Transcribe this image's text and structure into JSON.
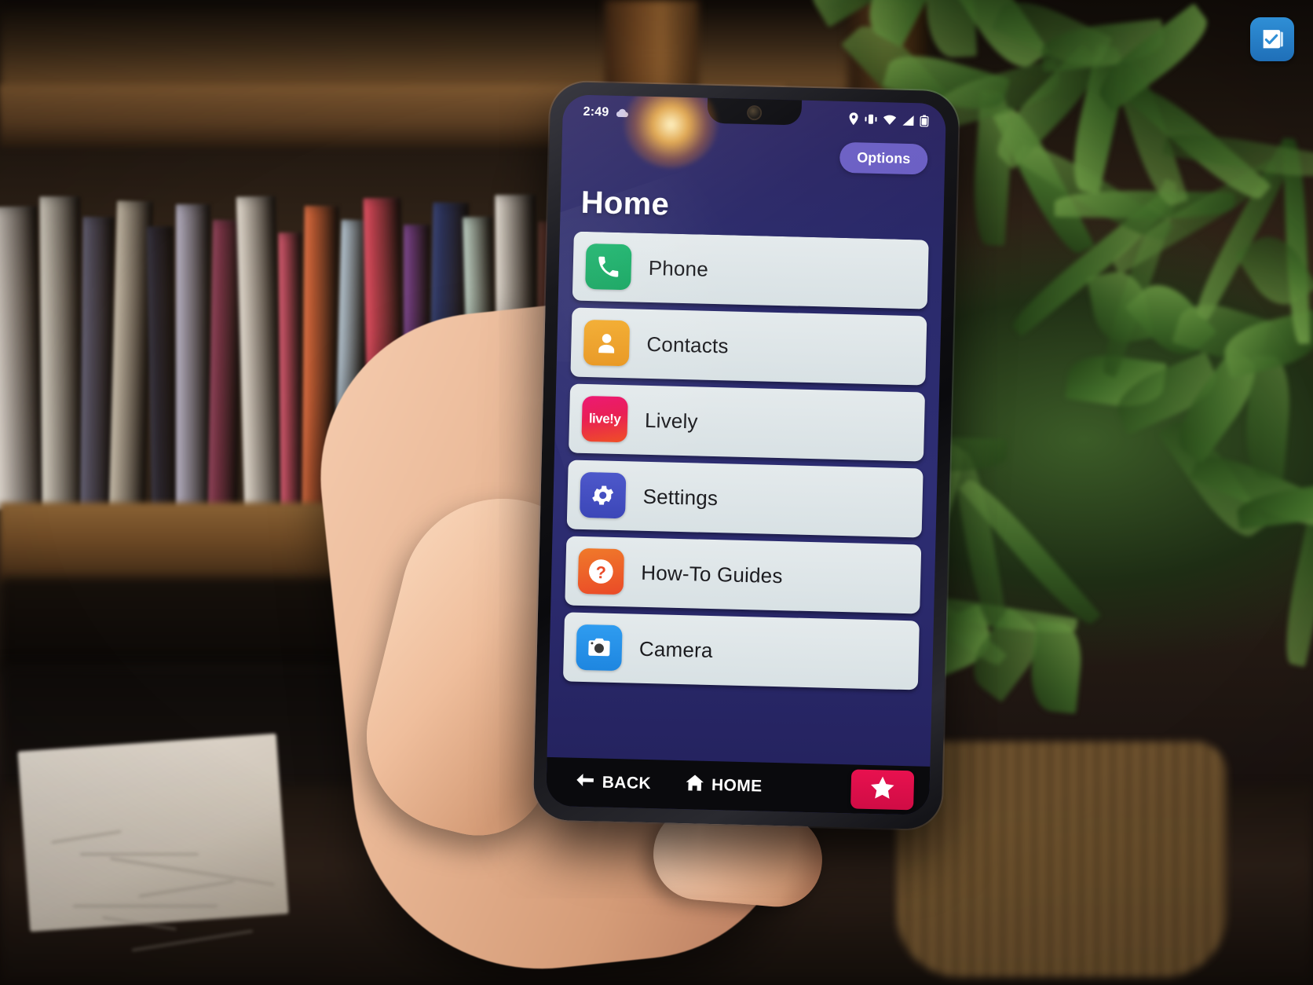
{
  "watermark": {
    "icon": "checklist-logo-icon"
  },
  "phone": {
    "status_bar": {
      "time": "2:49",
      "left_icons": [
        "cloud-icon"
      ],
      "right_icons": [
        "location-pin-icon",
        "vibrate-icon",
        "wifi-icon",
        "signal-icon",
        "battery-icon"
      ]
    },
    "options_button": {
      "label": "Options",
      "color": "#6b5fc4"
    },
    "page_title": "Home",
    "list": {
      "items": [
        {
          "label": "Phone",
          "icon": "phone-handset-icon",
          "color": "#17b26a"
        },
        {
          "label": "Contacts",
          "icon": "person-icon",
          "color": "#f2a826"
        },
        {
          "label": "Lively",
          "icon": "lively-logo-icon",
          "color": "#ec0f6e",
          "icon_text": "live!y"
        },
        {
          "label": "Settings",
          "icon": "gear-icon",
          "color": "#4a55c9"
        },
        {
          "label": "How-To Guides",
          "icon": "question-mark-icon",
          "color": "#ea4a28"
        },
        {
          "label": "Camera",
          "icon": "camera-icon",
          "color": "#2f9cf0"
        }
      ]
    },
    "nav_bar": {
      "back_label": "BACK",
      "home_label": "HOME",
      "star_button": {
        "icon": "star-icon",
        "color": "#e8114f"
      }
    }
  }
}
